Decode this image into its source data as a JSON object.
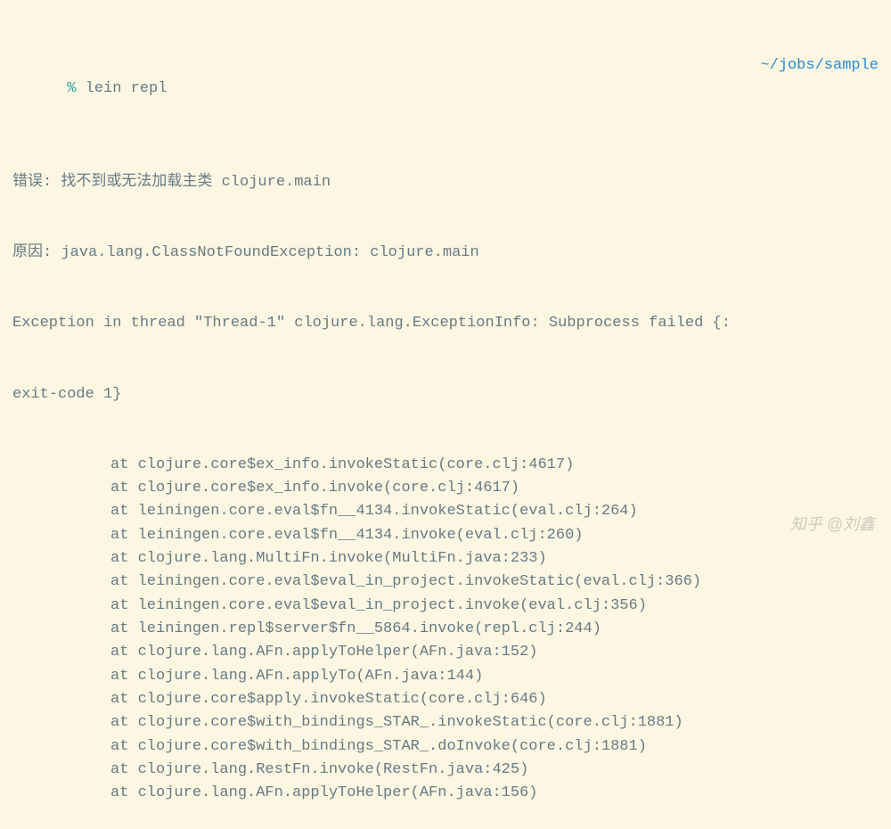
{
  "prompt": {
    "symbol": "%",
    "command": "lein repl",
    "cwd": "~/jobs/sample"
  },
  "output": {
    "error_line": "错误: 找不到或无法加载主类 clojure.main",
    "cause_line": "原因: java.lang.ClassNotFoundException: clojure.main",
    "exception_line1": "Exception in thread \"Thread-1\" clojure.lang.ExceptionInfo: Subprocess failed {:",
    "exception_line2": "exit-code 1}"
  },
  "stacktrace": [
    "at clojure.core$ex_info.invokeStatic(core.clj:4617)",
    "at clojure.core$ex_info.invoke(core.clj:4617)",
    "at leiningen.core.eval$fn__4134.invokeStatic(eval.clj:264)",
    "at leiningen.core.eval$fn__4134.invoke(eval.clj:260)",
    "at clojure.lang.MultiFn.invoke(MultiFn.java:233)",
    "at leiningen.core.eval$eval_in_project.invokeStatic(eval.clj:366)",
    "at leiningen.core.eval$eval_in_project.invoke(eval.clj:356)",
    "at leiningen.repl$server$fn__5864.invoke(repl.clj:244)",
    "at clojure.lang.AFn.applyToHelper(AFn.java:152)",
    "at clojure.lang.AFn.applyTo(AFn.java:144)",
    "at clojure.core$apply.invokeStatic(core.clj:646)",
    "at clojure.core$with_bindings_STAR_.invokeStatic(core.clj:1881)",
    "at clojure.core$with_bindings_STAR_.doInvoke(core.clj:1881)",
    "at clojure.lang.RestFn.invoke(RestFn.java:425)",
    "at clojure.lang.AFn.applyToHelper(AFn.java:156)"
  ],
  "watermark": "知乎 @刘鑫"
}
